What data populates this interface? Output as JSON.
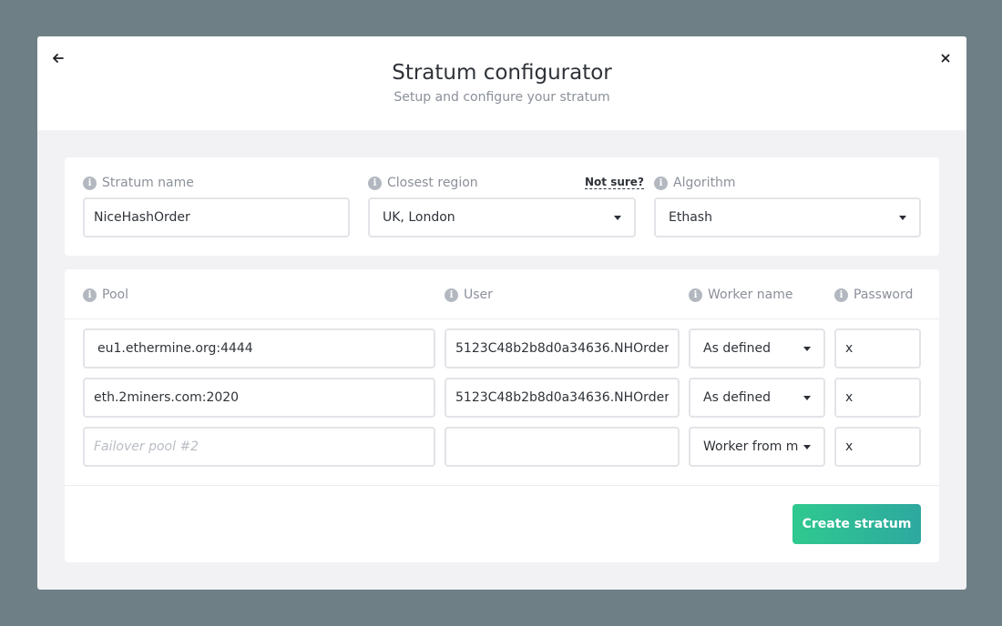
{
  "header": {
    "title": "Stratum configurator",
    "subtitle": "Setup and configure your stratum",
    "back_icon": "arrow-left-icon",
    "close_icon": "close-icon"
  },
  "settings": {
    "stratum_name": {
      "label": "Stratum name",
      "value": "NiceHashOrder"
    },
    "region": {
      "label": "Closest region",
      "help_link": "Not sure?",
      "value": "UK, London"
    },
    "algorithm": {
      "label": "Algorithm",
      "value": "Ethash"
    }
  },
  "pools": {
    "headers": {
      "pool": "Pool",
      "user": "User",
      "worker": "Worker name",
      "password": "Password"
    },
    "rows": [
      {
        "pool": "eu1.ethermine.org:4444",
        "pool_placeholder": "",
        "user": "5123C48b2b8d0a34636.NHOrder",
        "worker": "As defined",
        "password": "x"
      },
      {
        "pool": "eth.2miners.com:2020",
        "pool_placeholder": "",
        "user": "5123C48b2b8d0a34636.NHOrder",
        "worker": "As defined",
        "password": "x"
      },
      {
        "pool": "",
        "pool_placeholder": "Failover pool #2",
        "user": "",
        "worker": "Worker from main",
        "password": "x"
      }
    ]
  },
  "actions": {
    "create_label": "Create stratum"
  },
  "colors": {
    "accent_start": "#2fc98f",
    "accent_end": "#2ea8a0",
    "backdrop": "#6e7f86"
  }
}
